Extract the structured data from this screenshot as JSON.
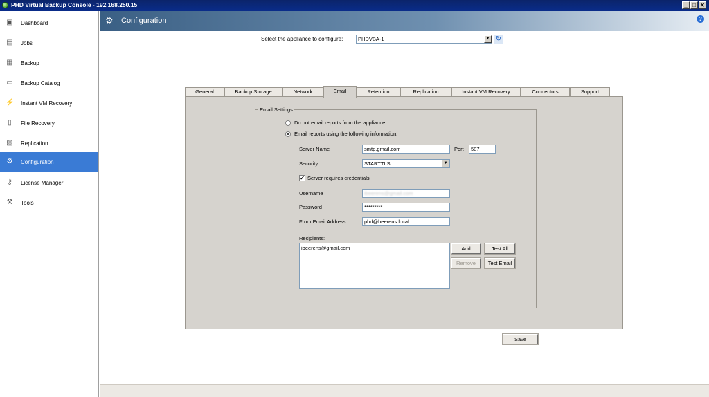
{
  "window": {
    "title": "PHD Virtual Backup Console - 192.168.250.15",
    "controls": [
      "_",
      "□",
      "✕"
    ]
  },
  "sidebar": {
    "items": [
      {
        "label": "Dashboard",
        "icon": "▣",
        "active": false
      },
      {
        "label": "Jobs",
        "icon": "▤",
        "active": false
      },
      {
        "label": "Backup",
        "icon": "▦",
        "active": false
      },
      {
        "label": "Backup Catalog",
        "icon": "▭",
        "active": false
      },
      {
        "label": "Instant VM Recovery",
        "icon": "⚡",
        "active": false
      },
      {
        "label": "File Recovery",
        "icon": "▯",
        "active": false
      },
      {
        "label": "Replication",
        "icon": "▧",
        "active": false
      },
      {
        "label": "Configuration",
        "icon": "⚙",
        "active": true
      },
      {
        "label": "License Manager",
        "icon": "⚷",
        "active": false
      },
      {
        "label": "Tools",
        "icon": "⚒",
        "active": false
      }
    ]
  },
  "header": {
    "title": "Configuration",
    "gear_icon": "⚙",
    "help_icon": "?"
  },
  "appliance": {
    "label": "Select the appliance to configure:",
    "value": "PHDVBA-1",
    "refresh_icon": "↻",
    "dropdown_arrow": "▼"
  },
  "tabs": [
    {
      "label": "General"
    },
    {
      "label": "Backup Storage"
    },
    {
      "label": "Network"
    },
    {
      "label": "Email"
    },
    {
      "label": "Retention"
    },
    {
      "label": "Replication"
    },
    {
      "label": "Instant VM Recovery"
    },
    {
      "label": "Connectors"
    },
    {
      "label": "Support"
    }
  ],
  "active_tab": "Email",
  "email": {
    "group_label": "Email Settings",
    "option_disable": "Do not email reports from the appliance",
    "option_enable": "Email reports using the following information:",
    "server_name_label": "Server Name",
    "server_name_value": "smtp.gmail.com",
    "port_label": "Port",
    "port_value": "587",
    "security_label": "Security",
    "security_value": "STARTTLS",
    "credentials_label": "Server requires credentials",
    "credentials_check": "✔",
    "username_label": "Username",
    "username_value": "ibeerens@gmail.com",
    "password_label": "Password",
    "password_value": "*********",
    "from_label": "From Email Address",
    "from_value": "phd@beerens.local",
    "recipients_label": "Recipients:",
    "recipients": [
      "ibeerens@gmail.com"
    ],
    "add_button": "Add",
    "test_all_button": "Test All",
    "remove_button": "Remove",
    "test_email_button": "Test Email"
  },
  "save_button": "Save"
}
